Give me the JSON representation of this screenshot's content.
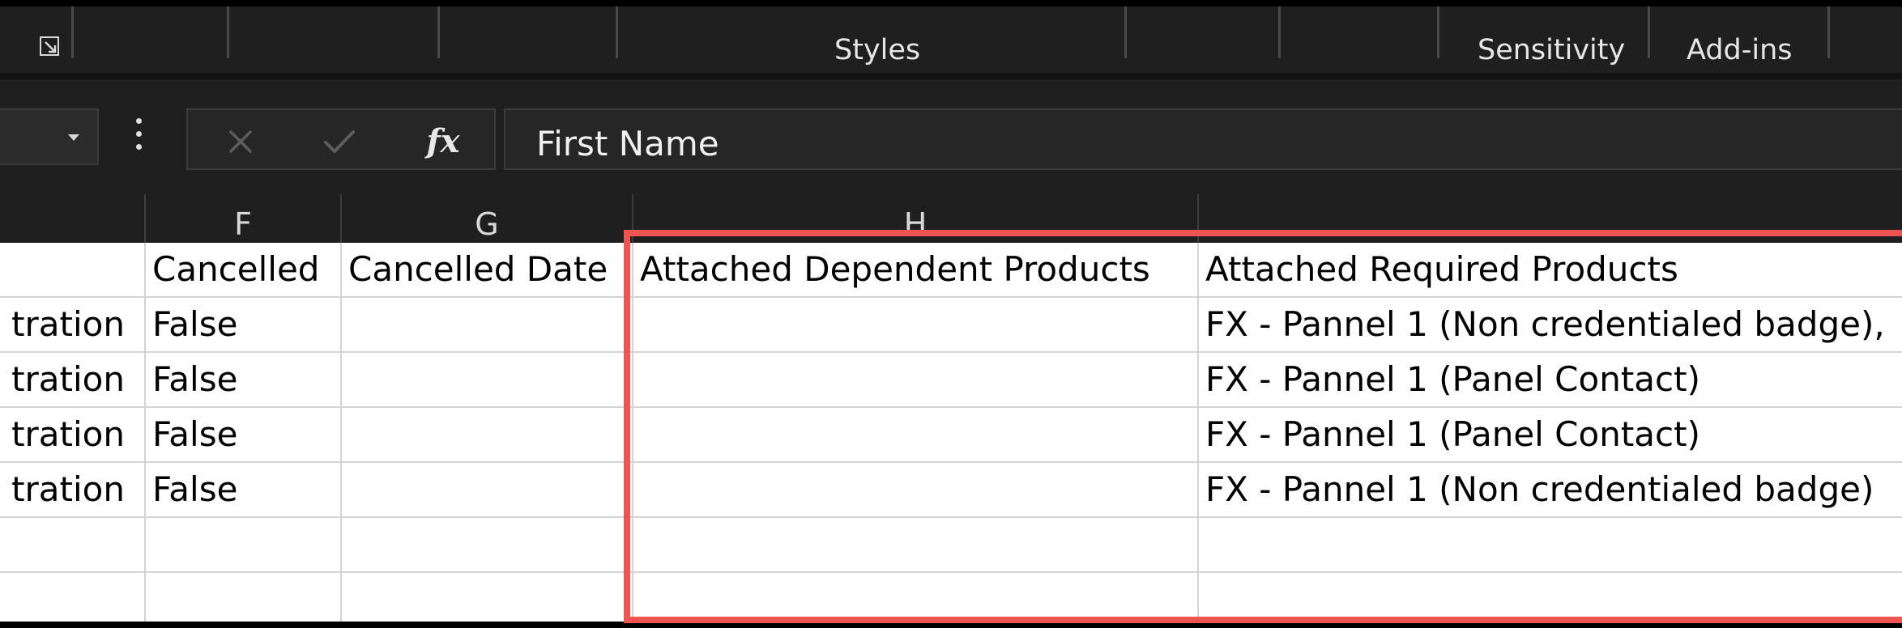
{
  "ribbon": {
    "groups": {
      "styles": "Styles",
      "sensitivity": "Sensitivity",
      "addins": "Add-ins"
    }
  },
  "formula_bar": {
    "name_box_value": "",
    "fx_label": "fx",
    "content": "First Name"
  },
  "columns": {
    "f": "F",
    "g": "G",
    "h": "H"
  },
  "rows": [
    {
      "e": "",
      "f": "Cancelled",
      "g": "Cancelled Date",
      "h": "Attached Dependent Products",
      "i": "Attached Required Products"
    },
    {
      "e": "tration",
      "f": "False",
      "g": "",
      "h": "",
      "i": "FX - Pannel 1 (Non credentialed badge),"
    },
    {
      "e": "tration",
      "f": "False",
      "g": "",
      "h": "",
      "i": "FX - Pannel 1 (Panel Contact)"
    },
    {
      "e": "tration",
      "f": "False",
      "g": "",
      "h": "",
      "i": "FX - Pannel 1 (Panel Contact)"
    },
    {
      "e": "tration",
      "f": "False",
      "g": "",
      "h": "",
      "i": "FX - Pannel 1 (Non credentialed badge)"
    },
    {
      "e": "",
      "f": "",
      "g": "",
      "h": "",
      "i": ""
    },
    {
      "e": "",
      "f": "",
      "g": "",
      "h": "",
      "i": ""
    }
  ],
  "colors": {
    "highlight_border": "#ee5450",
    "chrome_background": "#1f1f1f",
    "grid_line": "#d4d4d4"
  },
  "icons": {
    "dialog_launcher": "dialog-launcher-icon",
    "more": "more-vertical-icon",
    "cancel": "close-icon",
    "enter": "checkmark-icon",
    "insert_function": "fx-icon"
  }
}
